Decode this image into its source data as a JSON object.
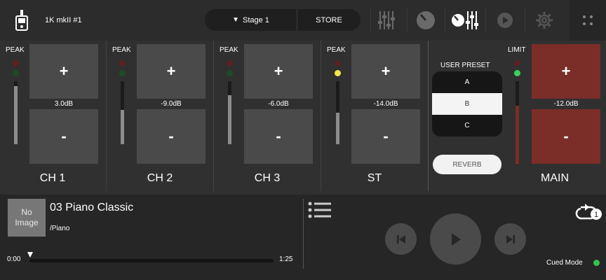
{
  "header": {
    "device_name": "1K mkII #1",
    "scene": "Stage 1",
    "store_label": "STORE"
  },
  "icons": [
    "device-icon",
    "dropdown-triangle-icon",
    "faders-icon",
    "knob-icon",
    "mixer-view-icon",
    "record-icon",
    "gear-icon",
    "grid-icon",
    "list-icon",
    "repeat-one-icon",
    "prev-icon",
    "play-icon",
    "next-icon"
  ],
  "channels": [
    {
      "name": "CH 1",
      "level": "3.0dB",
      "meter_label": "PEAK",
      "led_state": "off"
    },
    {
      "name": "CH 2",
      "level": "-9.0dB",
      "meter_label": "PEAK",
      "led_state": "off"
    },
    {
      "name": "CH 3",
      "level": "-6.0dB",
      "meter_label": "PEAK",
      "led_state": "off"
    },
    {
      "name": "ST",
      "level": "-14.0dB",
      "meter_label": "PEAK",
      "led_state": "yellow"
    }
  ],
  "main": {
    "name": "MAIN",
    "level": "-12.0dB",
    "meter_label": "LIMIT",
    "led_state": "green"
  },
  "fader_labels": {
    "up": "+",
    "down": "-"
  },
  "user_preset": {
    "title": "USER PRESET",
    "options": [
      "A",
      "B",
      "C"
    ],
    "selected": "B"
  },
  "reverb_label": "REVERB",
  "player": {
    "no_image": "No Image",
    "track_title": "03 Piano Classic",
    "track_path": "/Piano",
    "time_current": "0:00",
    "time_total": "1:25",
    "progress": 0.0,
    "cued_mode_label": "Cued Mode",
    "cued_mode_on": true
  },
  "colors": {
    "accent_main": "#7a2e27",
    "led_yellow": "#f2e64a",
    "led_green": "#3bd15c",
    "cued_green": "#34c24f"
  }
}
